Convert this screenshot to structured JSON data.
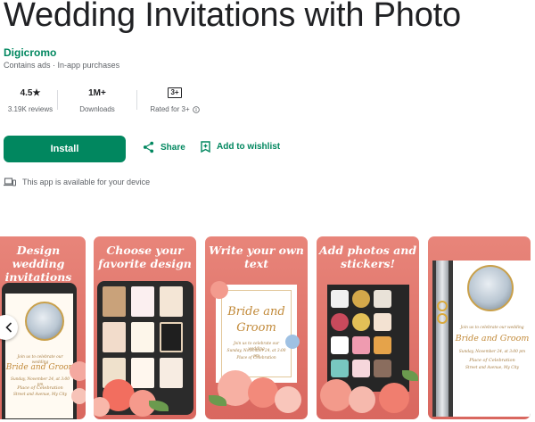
{
  "app": {
    "title": "Wedding Invitations with Photo",
    "developer": "Digicromo",
    "notes": "Contains ads · In-app purchases"
  },
  "stats": {
    "rating": "4.5★",
    "reviews": "3.19K reviews",
    "downloads_value": "1M+",
    "downloads_label": "Downloads",
    "content_rating_badge": "3+",
    "content_rating_label": "Rated for 3+"
  },
  "actions": {
    "install": "Install",
    "share": "Share",
    "wishlist": "Add to wishlist"
  },
  "availability": "This app is available for your device",
  "screenshots": [
    {
      "caption": "Design wedding invitations"
    },
    {
      "caption": "Choose your favorite design"
    },
    {
      "caption": "Write your own text"
    },
    {
      "caption": "Add photos and stickers!"
    },
    {
      "caption": ""
    }
  ],
  "invite": {
    "line1": "Join us to celebrate our wedding",
    "names": "Bride and Groom",
    "date": "Sunday, November 24, at 3:00 pm",
    "place": "Place of Celebration",
    "address": "Street and Avenue, My City"
  },
  "colors": {
    "accent": "#01875f",
    "screenshot_bg": "#e0776d",
    "gold": "#c28a3a"
  },
  "icons": {
    "share": "share-icon",
    "wishlist": "bookmark-add-icon",
    "device": "laptop-phone-icon",
    "info": "info-icon",
    "prev": "chevron-left-icon"
  }
}
